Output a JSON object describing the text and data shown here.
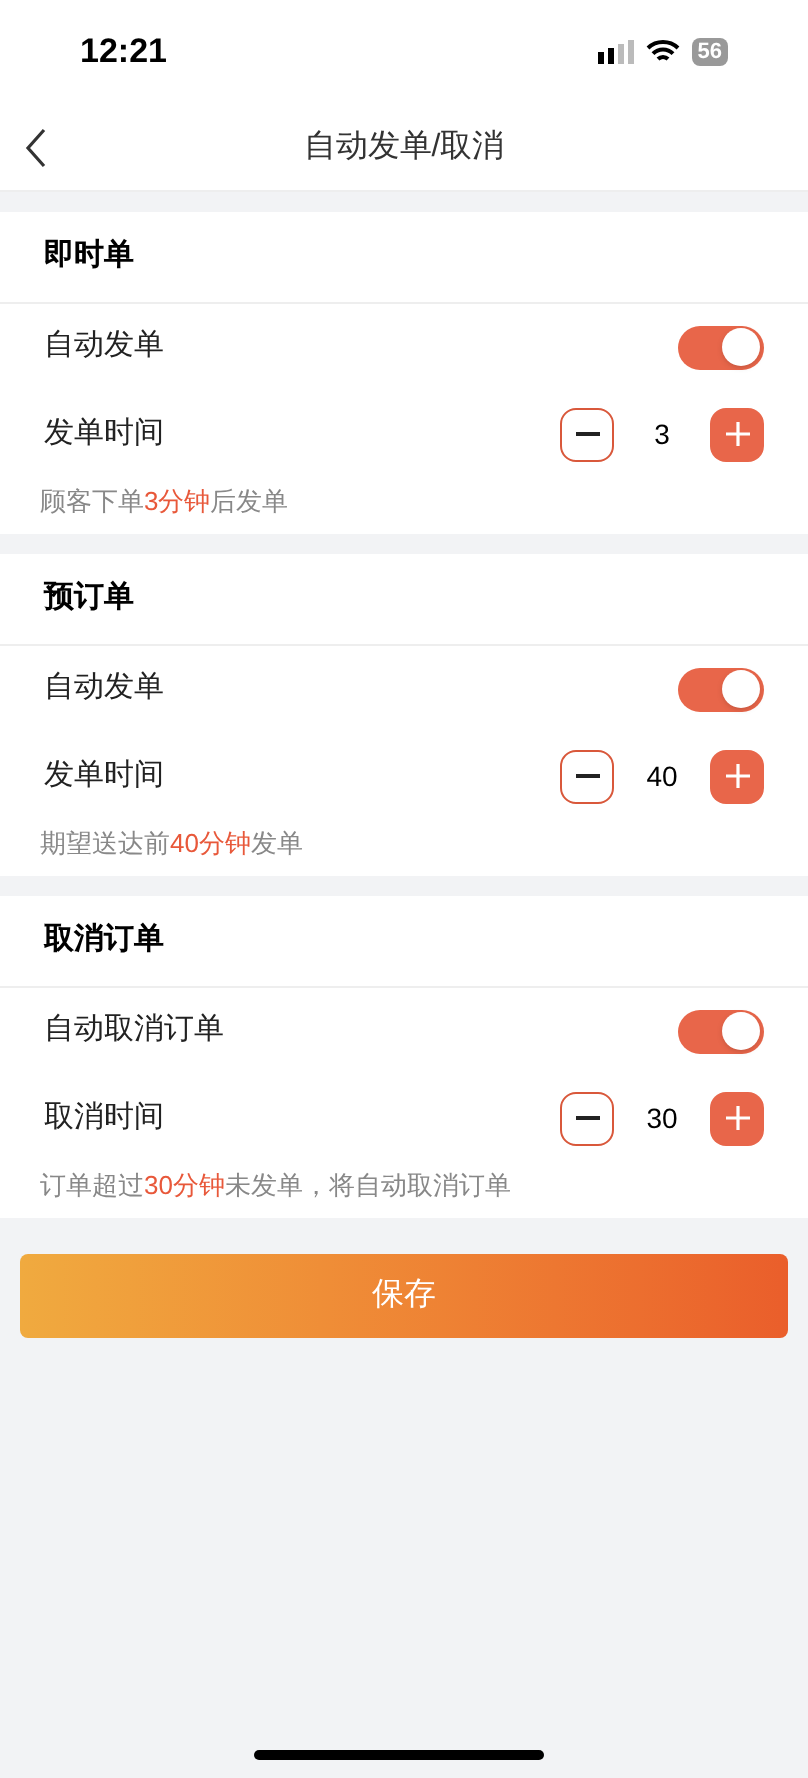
{
  "status_bar": {
    "time": "12:21",
    "battery": "56"
  },
  "nav": {
    "title": "自动发单/取消"
  },
  "sections": [
    {
      "title": "即时单",
      "toggle": {
        "label": "自动发单",
        "on": true
      },
      "stepper": {
        "label": "发单时间",
        "value": "3",
        "minus": true
      },
      "hint": {
        "before": "顾客下单",
        "highlight": "3分钟",
        "after": "后发单"
      }
    },
    {
      "title": "预订单",
      "toggle": {
        "label": "自动发单",
        "on": true
      },
      "stepper": {
        "label": "发单时间",
        "value": "40",
        "minus": true
      },
      "hint": {
        "before": "期望送达前",
        "highlight": "40分钟",
        "after": "发单"
      }
    },
    {
      "title": "取消订单",
      "toggle": {
        "label": "自动取消订单",
        "on": true
      },
      "stepper": {
        "label": "取消时间",
        "value": "30",
        "minus": true
      },
      "hint": {
        "before": "订单超过",
        "highlight": "30分钟",
        "after": "未发单，将自动取消订单"
      }
    }
  ],
  "save_button": "保存"
}
